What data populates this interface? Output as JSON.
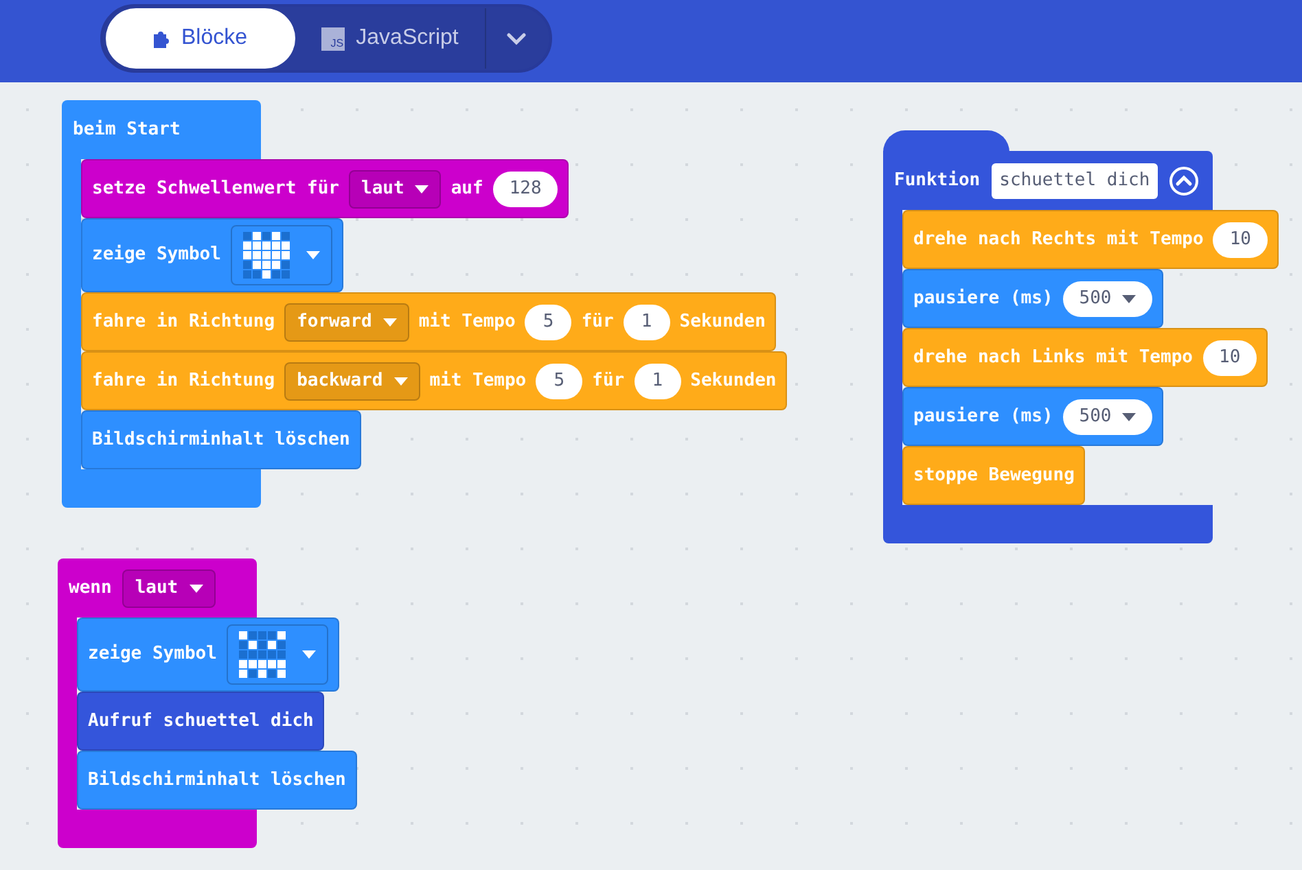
{
  "toolbar": {
    "tabs": [
      {
        "label": "Blöcke",
        "selected": true,
        "kind": "blocks"
      },
      {
        "label": "JavaScript",
        "selected": false,
        "kind": "js",
        "icon_text": "JS"
      }
    ]
  },
  "stacks": [
    {
      "kind": "hat",
      "color": "#2e8fff",
      "header": [
        {
          "kind": "text",
          "text": "beim Start"
        }
      ],
      "blocks": [
        {
          "color": "#cc00cc",
          "parts": [
            {
              "kind": "text",
              "text": "setze Schwellenwert für"
            },
            {
              "kind": "dropdown",
              "text": "laut"
            },
            {
              "kind": "text",
              "text": "auf"
            },
            {
              "kind": "number",
              "text": "128"
            }
          ]
        },
        {
          "color": "#2e8fff",
          "parts": [
            {
              "kind": "text",
              "text": "zeige Symbol"
            },
            {
              "kind": "leds",
              "leds": [
                [
                  false,
                  true,
                  false,
                  true,
                  false
                ],
                [
                  true,
                  true,
                  true,
                  true,
                  true
                ],
                [
                  true,
                  true,
                  true,
                  true,
                  true
                ],
                [
                  false,
                  true,
                  true,
                  true,
                  false
                ],
                [
                  false,
                  false,
                  true,
                  false,
                  false
                ]
              ]
            }
          ]
        },
        {
          "color": "#ffab19",
          "parts": [
            {
              "kind": "text",
              "text": "fahre in Richtung"
            },
            {
              "kind": "dropdown",
              "text": "forward"
            },
            {
              "kind": "text",
              "text": "mit Tempo"
            },
            {
              "kind": "number",
              "text": "5"
            },
            {
              "kind": "text",
              "text": "für"
            },
            {
              "kind": "number",
              "text": "1"
            },
            {
              "kind": "text",
              "text": "Sekunden"
            }
          ]
        },
        {
          "color": "#ffab19",
          "parts": [
            {
              "kind": "text",
              "text": "fahre in Richtung"
            },
            {
              "kind": "dropdown",
              "text": "backward"
            },
            {
              "kind": "text",
              "text": "mit Tempo"
            },
            {
              "kind": "number",
              "text": "5"
            },
            {
              "kind": "text",
              "text": "für"
            },
            {
              "kind": "number",
              "text": "1"
            },
            {
              "kind": "text",
              "text": "Sekunden"
            }
          ]
        },
        {
          "color": "#2e8fff",
          "parts": [
            {
              "kind": "text",
              "text": "Bildschirminhalt löschen"
            }
          ]
        }
      ]
    },
    {
      "kind": "hat",
      "color": "#cc00cc",
      "header": [
        {
          "kind": "text",
          "text": "wenn"
        },
        {
          "kind": "dropdown",
          "text": "laut"
        }
      ],
      "blocks": [
        {
          "color": "#2e8fff",
          "parts": [
            {
              "kind": "text",
              "text": "zeige Symbol"
            },
            {
              "kind": "leds",
              "leds": [
                [
                  true,
                  false,
                  false,
                  false,
                  true
                ],
                [
                  false,
                  true,
                  false,
                  true,
                  false
                ],
                [
                  false,
                  false,
                  false,
                  false,
                  false
                ],
                [
                  true,
                  true,
                  true,
                  true,
                  true
                ],
                [
                  true,
                  false,
                  true,
                  false,
                  true
                ]
              ]
            }
          ]
        },
        {
          "color": "#3455db",
          "parts": [
            {
              "kind": "text",
              "text": "Aufruf schuettel dich"
            }
          ]
        },
        {
          "color": "#2e8fff",
          "parts": [
            {
              "kind": "text",
              "text": "Bildschirminhalt löschen"
            }
          ]
        }
      ]
    },
    {
      "kind": "function",
      "color": "#3455db",
      "header": [
        {
          "kind": "text",
          "text": "Funktion"
        },
        {
          "kind": "field",
          "text": "schuettel dich"
        },
        {
          "kind": "collapse"
        }
      ],
      "blocks": [
        {
          "color": "#ffab19",
          "parts": [
            {
              "kind": "text",
              "text": "drehe nach Rechts mit Tempo"
            },
            {
              "kind": "number",
              "text": "10"
            }
          ]
        },
        {
          "color": "#2e8fff",
          "parts": [
            {
              "kind": "text",
              "text": "pausiere (ms)"
            },
            {
              "kind": "number_dropdown",
              "text": "500"
            }
          ]
        },
        {
          "color": "#ffab19",
          "parts": [
            {
              "kind": "text",
              "text": "drehe nach Links mit Tempo"
            },
            {
              "kind": "number",
              "text": "10"
            }
          ]
        },
        {
          "color": "#2e8fff",
          "parts": [
            {
              "kind": "text",
              "text": "pausiere (ms)"
            },
            {
              "kind": "number_dropdown",
              "text": "500"
            }
          ]
        },
        {
          "color": "#ffab19",
          "parts": [
            {
              "kind": "text",
              "text": "stoppe Bewegung"
            }
          ]
        }
      ]
    }
  ]
}
